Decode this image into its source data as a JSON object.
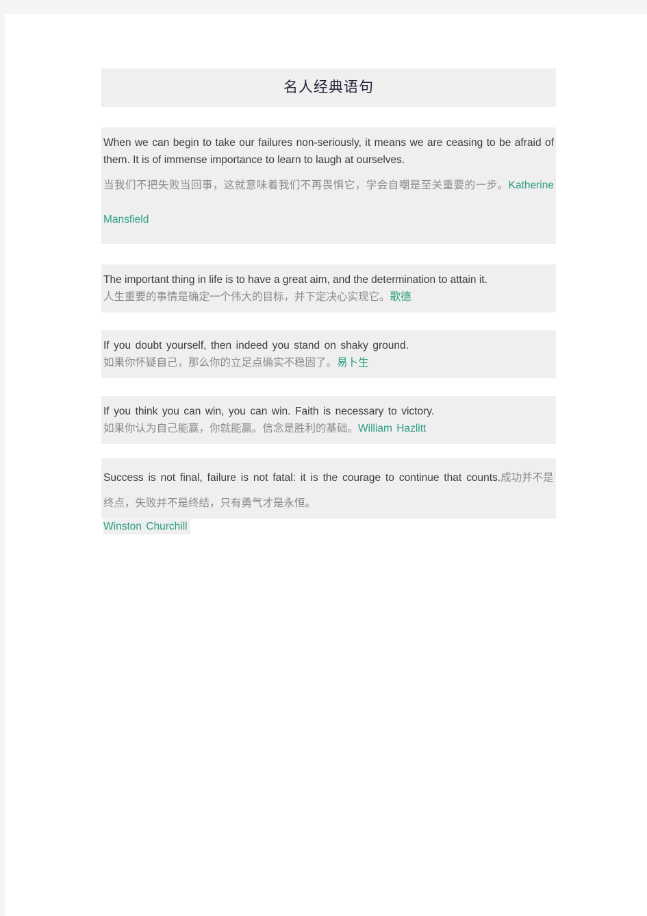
{
  "document": {
    "title": "名人经典语句",
    "accent_color": "#2a9d82",
    "block_background": "#efefef",
    "page_background": "#ffffff",
    "canvas_background": "#f4f4f4",
    "english_text_color": "#3a3a42",
    "chinese_text_color": "#8a8a8a",
    "title_color": "#232339"
  },
  "quotes": [
    {
      "id": "quote-1",
      "english": "When we can begin to take our failures non-seriously, it means we are ceasing to be afraid of them. It is of immense importance to learn to laugh at ourselves.",
      "chinese": "当我们不把失败当回事，这就意味着我们不再畏惧它，学会自嘲是至关重要的一步。",
      "author": "Katherine Mansfield",
      "author_language": "en",
      "layout": "stacked"
    },
    {
      "id": "quote-2",
      "english": "The important thing in life is to have a great aim, and the determination to attain it.",
      "chinese": "人生重要的事情是确定一个伟大的目标，并下定决心实现它。",
      "author": "歌德",
      "author_language": "cn",
      "layout": "stacked"
    },
    {
      "id": "quote-3",
      "english": "If you doubt yourself, then indeed you stand on shaky ground.",
      "chinese": "如果你怀疑自己，那么你的立足点确实不稳固了。",
      "author": "易卜生",
      "author_language": "cn",
      "layout": "stacked"
    },
    {
      "id": "quote-4",
      "english": "If you think you can win, you can win. Faith is necessary to victory.",
      "chinese": "如果你认为自己能赢，你就能赢。信念是胜利的基础。",
      "author": "William Hazlitt",
      "author_language": "en",
      "layout": "stacked"
    },
    {
      "id": "quote-5",
      "english": "Success is not final, failure is not fatal: it is the courage to continue that counts.",
      "chinese": "成功并不是终点，失败并不是终结，只有勇气才是永恒。",
      "author": "Winston Churchill",
      "author_language": "en",
      "layout": "inline"
    }
  ]
}
